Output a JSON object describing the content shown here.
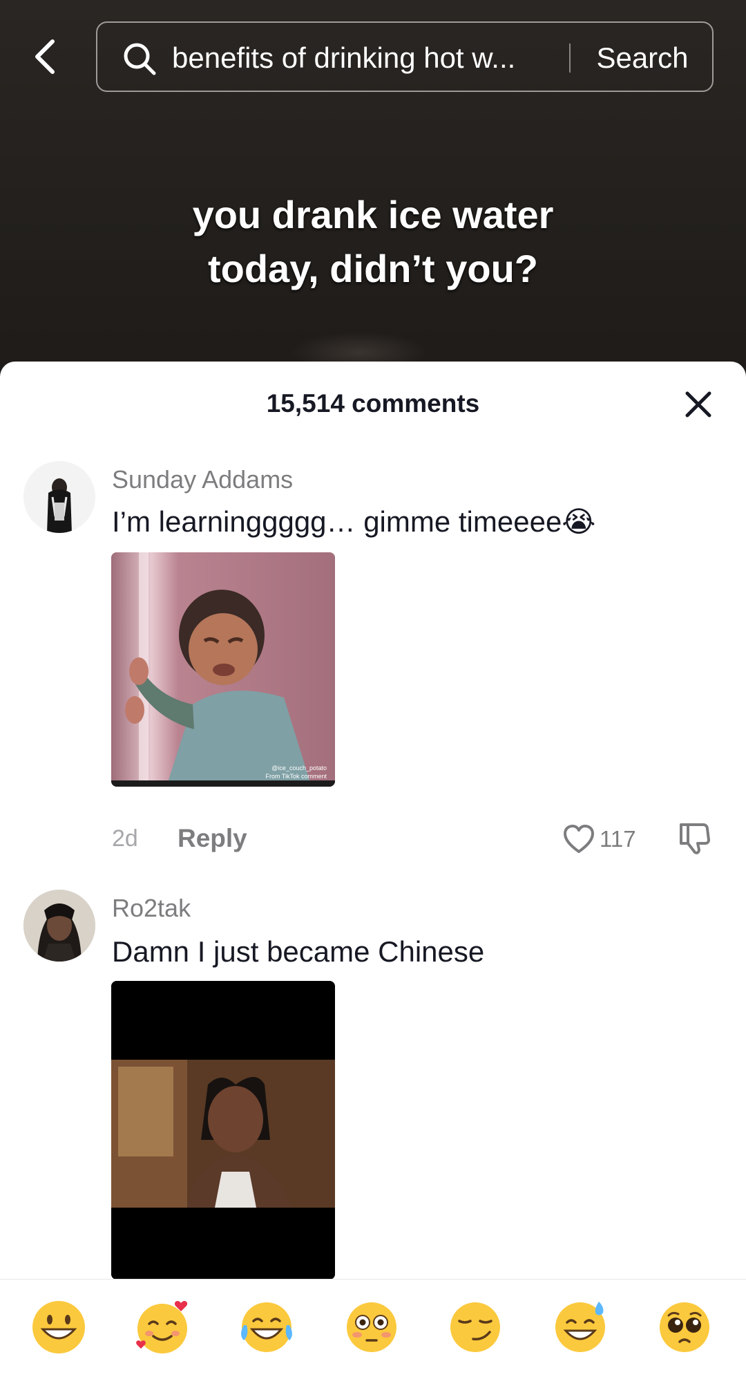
{
  "search": {
    "query": "benefits of drinking hot w...",
    "button_label": "Search"
  },
  "video": {
    "caption_line1": "you drank ice water",
    "caption_line2": "today, didn’t you?"
  },
  "comments_panel": {
    "title": "15,514 comments"
  },
  "comments": [
    {
      "username": "Sunday Addams",
      "text": "I’m learninggggg… gimme timeeee😭",
      "image_watermark_1": "@ice_couch_potato",
      "image_watermark_2": "From TikTok comment",
      "time": "2d",
      "reply_label": "Reply",
      "likes": "117"
    },
    {
      "username": "Ro2tak",
      "text": "Damn I just became Chinese"
    }
  ],
  "emoji_bar": {
    "emojis": [
      "grinning-face",
      "smiling-face-with-hearts",
      "tears-of-joy",
      "flushed-face",
      "smirking-face",
      "grinning-sweat",
      "pleading-face"
    ]
  },
  "colors": {
    "sheet_bg": "#ffffff",
    "primary_text": "#161823",
    "secondary_text": "#7d7d7f",
    "emoji_yellow": "#fbc93d"
  }
}
